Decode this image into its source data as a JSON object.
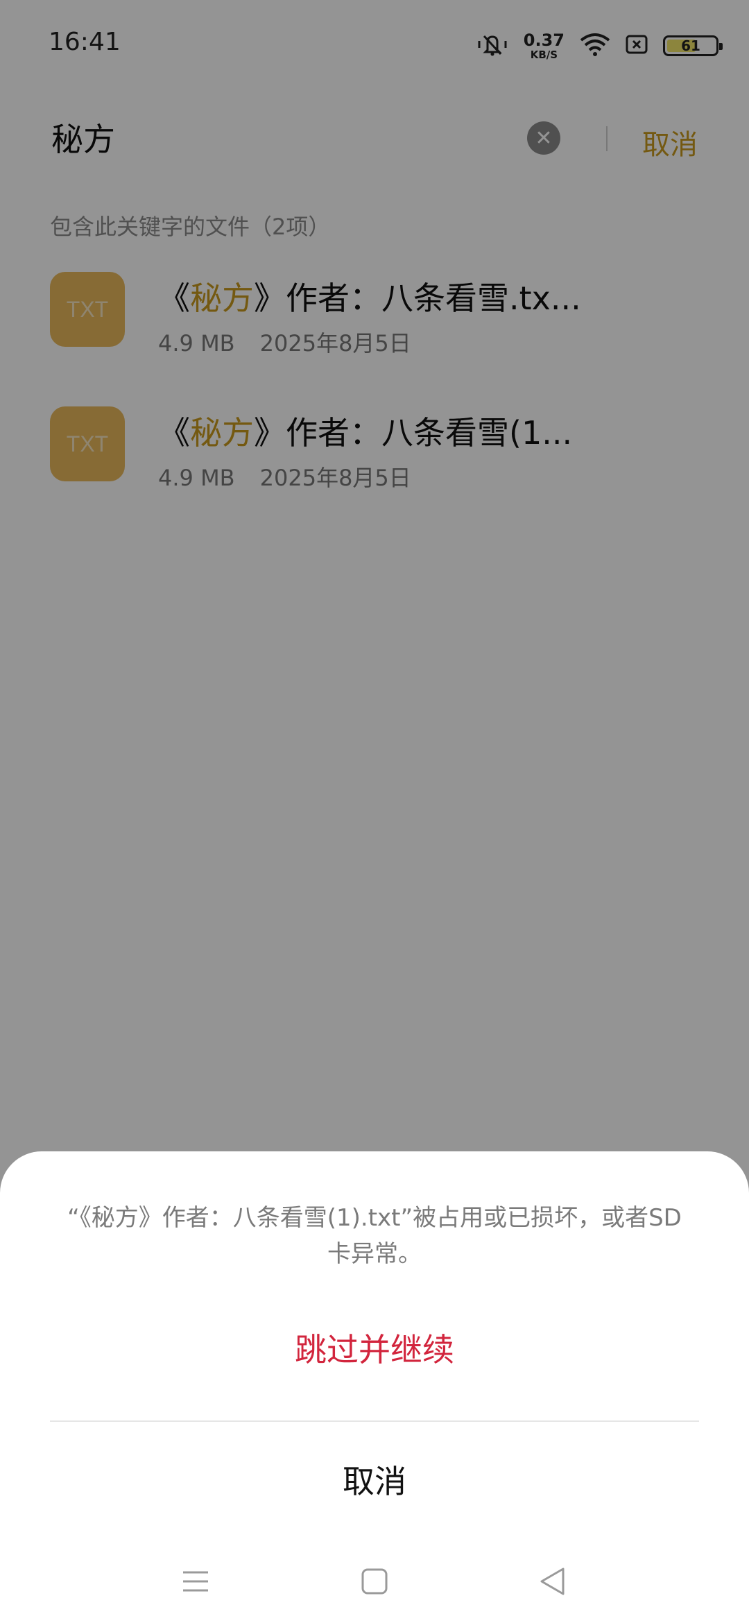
{
  "status_bar": {
    "time": "16:41",
    "speed_value": "0.37",
    "speed_unit": "KB/S",
    "battery_level": "61",
    "battery_fraction": 0.61,
    "icons": [
      "mute-icon",
      "wifi-icon",
      "sim-icon",
      "battery-icon"
    ]
  },
  "search": {
    "query": "秘方",
    "cancel_label": "取消"
  },
  "results": {
    "section_label": "包含此关键字的文件（2项）",
    "files": [
      {
        "name_prefix": "《",
        "name_highlight": "秘方",
        "name_suffix": "》作者：八条看雪.tx...",
        "icon_label": "TXT",
        "size": "4.9 MB",
        "date": "2025年8月5日"
      },
      {
        "name_prefix": "《",
        "name_highlight": "秘方",
        "name_suffix": "》作者：八条看雪(1...",
        "icon_label": "TXT",
        "size": "4.9 MB",
        "date": "2025年8月5日"
      }
    ]
  },
  "dialog": {
    "message": "“《秘方》作者：八条看雪(1).txt”被占用或已损坏，或者SD 卡异常。",
    "skip_label": "跳过并继续",
    "cancel_label": "取消"
  },
  "nav": {
    "icons": [
      "menu-icon",
      "home-icon",
      "back-icon"
    ]
  },
  "colors": {
    "accent": "#c99a1e",
    "danger": "#d2253d",
    "file_icon": "#e8b85c"
  }
}
